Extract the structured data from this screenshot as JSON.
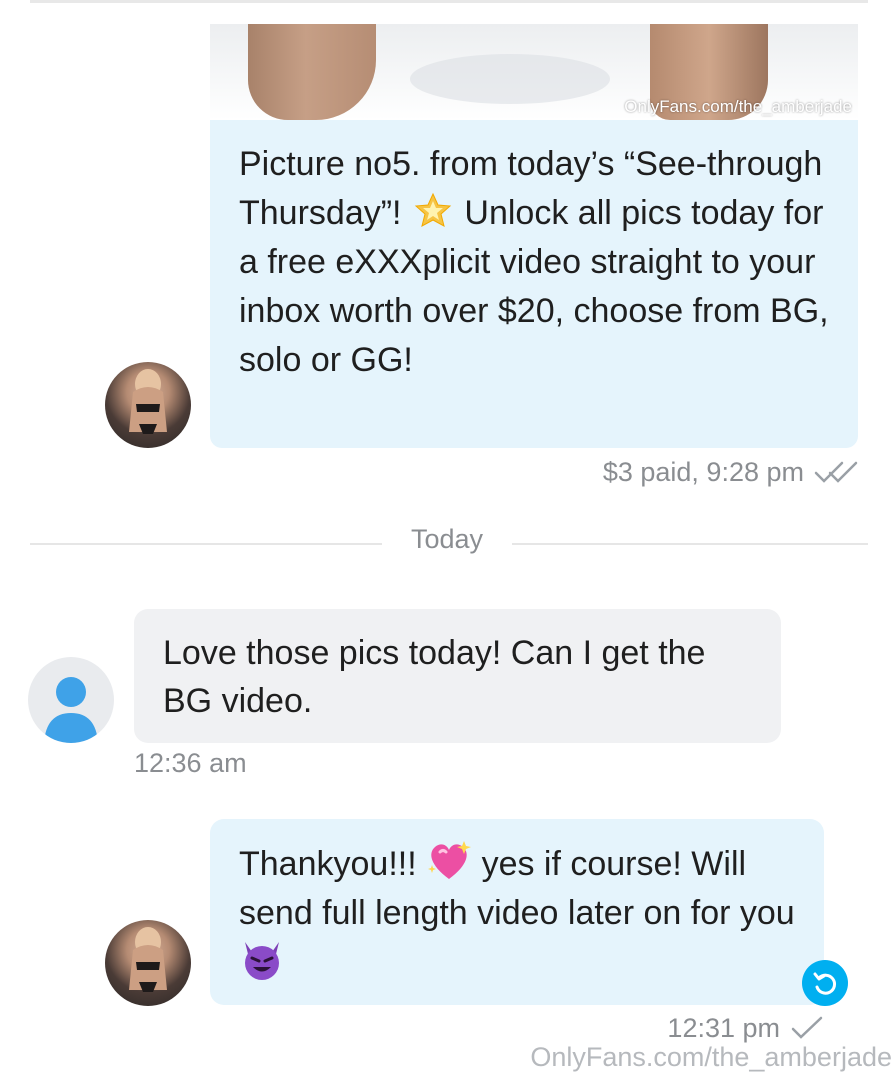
{
  "photo": {
    "watermark": "OnlyFans.com/the_amberjade"
  },
  "messages": [
    {
      "text_part1": "Picture no5. from today’s “See-through Thursday”!",
      "emoji": "glowing-star",
      "text_part2": "Unlock all pics today for a free eXXXplicit video straight to your inbox worth over $20, choose from BG, solo or GG!",
      "meta": "$3 paid, 9:28 pm"
    },
    {
      "text": "Love those pics today! Can I get the BG video.",
      "meta": "12:36 am"
    },
    {
      "text_part1": "Thankyou!!!",
      "emoji1": "sparkling-heart",
      "text_part2": "yes if course! Will send full length video later on for you",
      "emoji2": "smiling-devil",
      "meta": "12:31 pm"
    }
  ],
  "divider": {
    "label": "Today"
  },
  "footer": {
    "watermark": "OnlyFans.com/the_amberjade"
  },
  "colors": {
    "outgoing_bubble": "#e5f4fc",
    "incoming_bubble": "#f0f1f3",
    "accent": "#00aff0"
  }
}
